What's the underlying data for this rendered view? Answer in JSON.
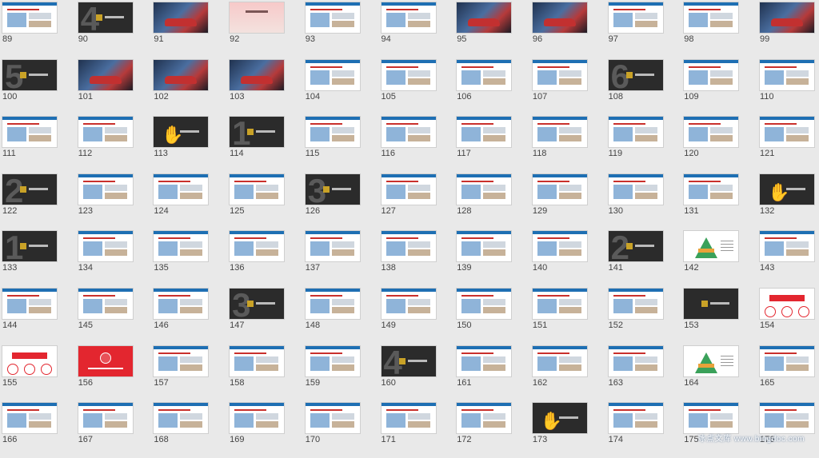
{
  "slides": [
    {
      "n": "89",
      "type": "white"
    },
    {
      "n": "90",
      "type": "dark",
      "big": "4"
    },
    {
      "n": "91",
      "type": "photo"
    },
    {
      "n": "92",
      "type": "pink"
    },
    {
      "n": "93",
      "type": "white"
    },
    {
      "n": "94",
      "type": "white"
    },
    {
      "n": "95",
      "type": "photo"
    },
    {
      "n": "96",
      "type": "photo"
    },
    {
      "n": "97",
      "type": "white"
    },
    {
      "n": "98",
      "type": "white"
    },
    {
      "n": "99",
      "type": "photo"
    },
    {
      "n": "100",
      "type": "dark",
      "big": "5"
    },
    {
      "n": "101",
      "type": "photo"
    },
    {
      "n": "102",
      "type": "photo"
    },
    {
      "n": "103",
      "type": "photo"
    },
    {
      "n": "104",
      "type": "white"
    },
    {
      "n": "105",
      "type": "white"
    },
    {
      "n": "106",
      "type": "white"
    },
    {
      "n": "107",
      "type": "white"
    },
    {
      "n": "108",
      "type": "dark",
      "big": "6"
    },
    {
      "n": "109",
      "type": "white"
    },
    {
      "n": "110",
      "type": "white"
    },
    {
      "n": "111",
      "type": "white"
    },
    {
      "n": "112",
      "type": "white"
    },
    {
      "n": "113",
      "type": "dark",
      "hand": true
    },
    {
      "n": "114",
      "type": "dark",
      "big": "1"
    },
    {
      "n": "115",
      "type": "white"
    },
    {
      "n": "116",
      "type": "white"
    },
    {
      "n": "117",
      "type": "white"
    },
    {
      "n": "118",
      "type": "white"
    },
    {
      "n": "119",
      "type": "white"
    },
    {
      "n": "120",
      "type": "white"
    },
    {
      "n": "121",
      "type": "white"
    },
    {
      "n": "122",
      "type": "dark",
      "big": "2"
    },
    {
      "n": "123",
      "type": "white"
    },
    {
      "n": "124",
      "type": "white"
    },
    {
      "n": "125",
      "type": "white"
    },
    {
      "n": "126",
      "type": "dark",
      "big": "3"
    },
    {
      "n": "127",
      "type": "white"
    },
    {
      "n": "128",
      "type": "white"
    },
    {
      "n": "129",
      "type": "white"
    },
    {
      "n": "130",
      "type": "white"
    },
    {
      "n": "131",
      "type": "white"
    },
    {
      "n": "132",
      "type": "dark",
      "hand": true
    },
    {
      "n": "133",
      "type": "dark",
      "big": "1"
    },
    {
      "n": "134",
      "type": "white"
    },
    {
      "n": "135",
      "type": "white"
    },
    {
      "n": "136",
      "type": "white"
    },
    {
      "n": "137",
      "type": "white"
    },
    {
      "n": "138",
      "type": "white"
    },
    {
      "n": "139",
      "type": "white"
    },
    {
      "n": "140",
      "type": "white"
    },
    {
      "n": "141",
      "type": "dark",
      "big": "2"
    },
    {
      "n": "142",
      "type": "pyr"
    },
    {
      "n": "143",
      "type": "white"
    },
    {
      "n": "144",
      "type": "white"
    },
    {
      "n": "145",
      "type": "white"
    },
    {
      "n": "146",
      "type": "white"
    },
    {
      "n": "147",
      "type": "dark",
      "big": "3"
    },
    {
      "n": "148",
      "type": "white"
    },
    {
      "n": "149",
      "type": "white"
    },
    {
      "n": "150",
      "type": "white"
    },
    {
      "n": "151",
      "type": "white"
    },
    {
      "n": "152",
      "type": "white"
    },
    {
      "n": "153",
      "type": "dark"
    },
    {
      "n": "154",
      "type": "banner"
    },
    {
      "n": "155",
      "type": "banner"
    },
    {
      "n": "156",
      "type": "red"
    },
    {
      "n": "157",
      "type": "white"
    },
    {
      "n": "158",
      "type": "white"
    },
    {
      "n": "159",
      "type": "white"
    },
    {
      "n": "160",
      "type": "dark",
      "big": "4"
    },
    {
      "n": "161",
      "type": "white"
    },
    {
      "n": "162",
      "type": "white"
    },
    {
      "n": "163",
      "type": "white"
    },
    {
      "n": "164",
      "type": "pyr"
    },
    {
      "n": "165",
      "type": "white"
    },
    {
      "n": "166",
      "type": "white"
    },
    {
      "n": "167",
      "type": "white"
    },
    {
      "n": "168",
      "type": "white"
    },
    {
      "n": "169",
      "type": "white"
    },
    {
      "n": "170",
      "type": "white"
    },
    {
      "n": "171",
      "type": "white"
    },
    {
      "n": "172",
      "type": "white"
    },
    {
      "n": "173",
      "type": "dark",
      "hand": true
    },
    {
      "n": "174",
      "type": "white"
    },
    {
      "n": "175",
      "type": "white"
    },
    {
      "n": "176",
      "type": "white"
    }
  ],
  "watermark": "冰点文库 www.bingdoc.com"
}
